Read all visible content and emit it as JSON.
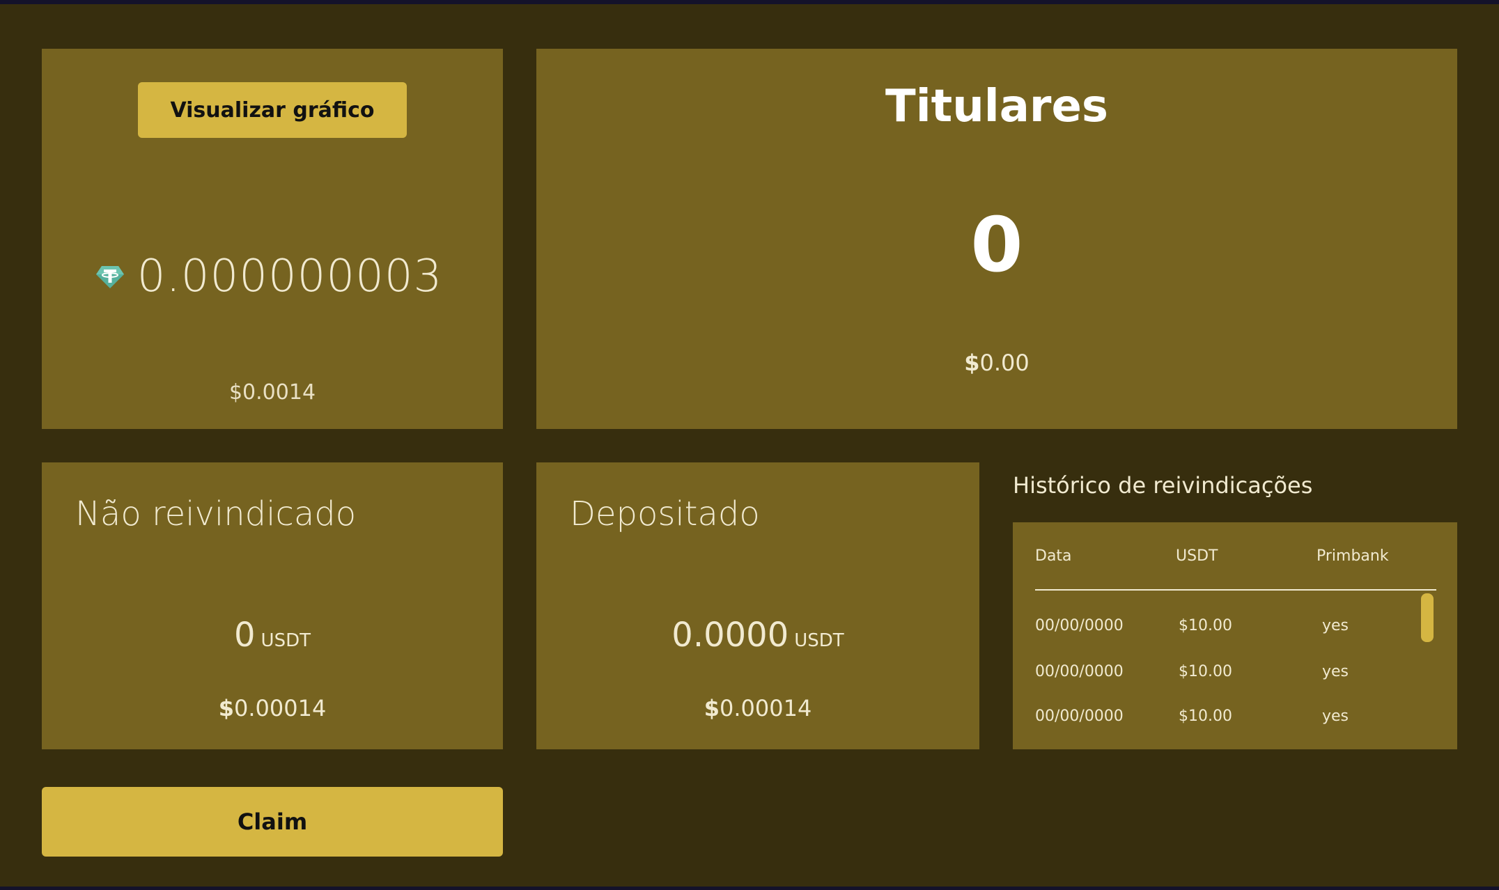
{
  "price_card": {
    "chart_button_label": "Visualizar gráfico",
    "token_icon": "tether-usdt-icon",
    "token_amount": "0.000000003",
    "usd_value": "$0.0014"
  },
  "holders": {
    "title": "Titulares",
    "count": "0",
    "usd_dollar": "$",
    "usd_value": "0.00"
  },
  "unclaimed": {
    "title": "Não reivindicado",
    "amount": "0",
    "unit": "USDT",
    "usd_dollar": "$",
    "usd_value": "0.00014"
  },
  "deposited": {
    "title": "Depositado",
    "amount": "0.0000",
    "unit": "USDT",
    "usd_dollar": "$",
    "usd_value": "0.00014"
  },
  "history": {
    "title": "Histórico de reivindicações",
    "columns": [
      "Data",
      "USDT",
      "Primbank"
    ],
    "rows": [
      {
        "date": "00/00/0000",
        "usdt": "$10.00",
        "primbank": "yes"
      },
      {
        "date": "00/00/0000",
        "usdt": "$10.00",
        "primbank": "yes"
      },
      {
        "date": "00/00/0000",
        "usdt": "$10.00",
        "primbank": "yes"
      }
    ]
  },
  "claim_button_label": "Claim",
  "colors": {
    "background": "#372e0e",
    "card": "#766320",
    "accent": "#d5b642",
    "text": "#f1ead0"
  }
}
